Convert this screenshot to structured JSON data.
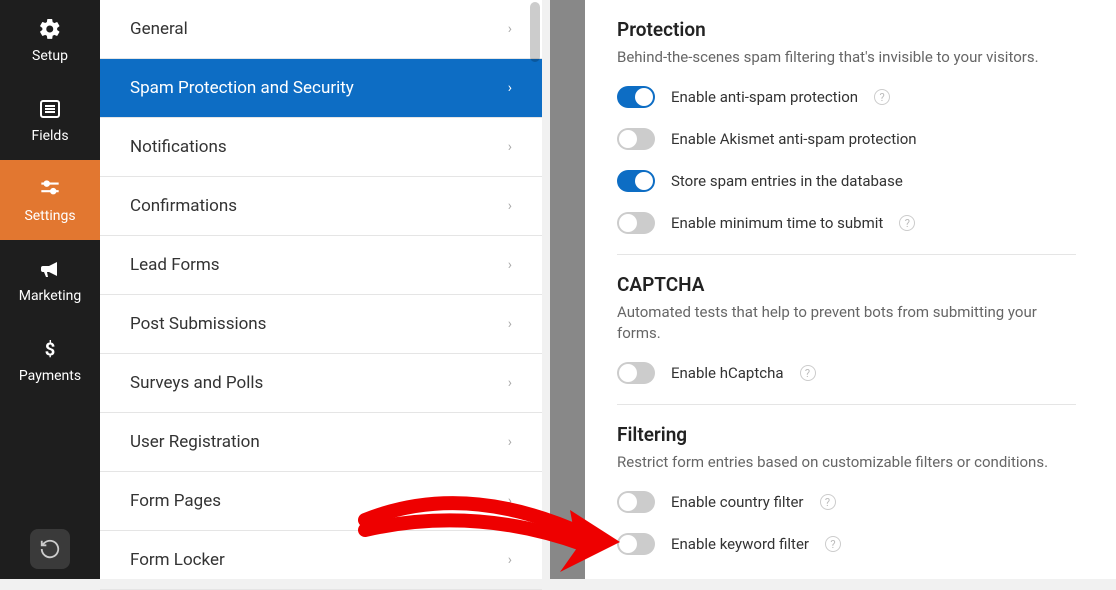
{
  "rail": {
    "items": [
      {
        "id": "setup",
        "label": "Setup"
      },
      {
        "id": "fields",
        "label": "Fields"
      },
      {
        "id": "settings",
        "label": "Settings"
      },
      {
        "id": "marketing",
        "label": "Marketing"
      },
      {
        "id": "payments",
        "label": "Payments"
      }
    ],
    "active": "settings"
  },
  "mid": {
    "items": [
      {
        "label": "General"
      },
      {
        "label": "Spam Protection and Security"
      },
      {
        "label": "Notifications"
      },
      {
        "label": "Confirmations"
      },
      {
        "label": "Lead Forms"
      },
      {
        "label": "Post Submissions"
      },
      {
        "label": "Surveys and Polls"
      },
      {
        "label": "User Registration"
      },
      {
        "label": "Form Pages"
      },
      {
        "label": "Form Locker"
      }
    ],
    "active": 1
  },
  "main": {
    "protection": {
      "title": "Protection",
      "sub": "Behind-the-scenes spam filtering that's invisible to your visitors.",
      "opts": [
        {
          "label": "Enable anti-spam protection",
          "on": true,
          "help": true
        },
        {
          "label": "Enable Akismet anti-spam protection",
          "on": false,
          "help": false
        },
        {
          "label": "Store spam entries in the database",
          "on": true,
          "help": false
        },
        {
          "label": "Enable minimum time to submit",
          "on": false,
          "help": true
        }
      ]
    },
    "captcha": {
      "title": "CAPTCHA",
      "sub": "Automated tests that help to prevent bots from submitting your forms.",
      "opts": [
        {
          "label": "Enable hCaptcha",
          "on": false,
          "help": true
        }
      ]
    },
    "filtering": {
      "title": "Filtering",
      "sub": "Restrict form entries based on customizable filters or conditions.",
      "opts": [
        {
          "label": "Enable country filter",
          "on": false,
          "help": true
        },
        {
          "label": "Enable keyword filter",
          "on": false,
          "help": true
        }
      ]
    }
  }
}
